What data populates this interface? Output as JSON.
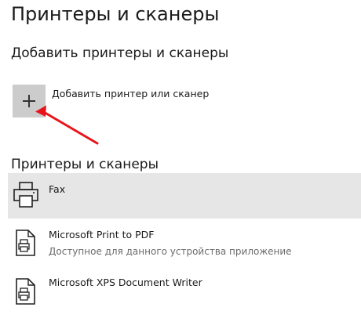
{
  "page": {
    "title": "Принтеры и сканеры"
  },
  "add_section": {
    "title": "Добавить принтеры и сканеры",
    "add_button_label": "Добавить принтер или сканер"
  },
  "printers_section": {
    "title": "Принтеры и сканеры",
    "items": [
      {
        "name": "Fax",
        "status": "",
        "icon": "fax-printer-icon",
        "selected": true
      },
      {
        "name": "Microsoft Print to PDF",
        "status": "Доступное для данного устройства приложение",
        "icon": "document-printer-icon",
        "selected": false
      },
      {
        "name": "Microsoft XPS Document Writer",
        "status": "",
        "icon": "document-printer-icon",
        "selected": false
      }
    ]
  },
  "colors": {
    "selected_background": "#e6e6e6",
    "add_button_background": "#cccccc",
    "arrow": "#e8141b",
    "secondary_text": "#6b6b6b"
  }
}
